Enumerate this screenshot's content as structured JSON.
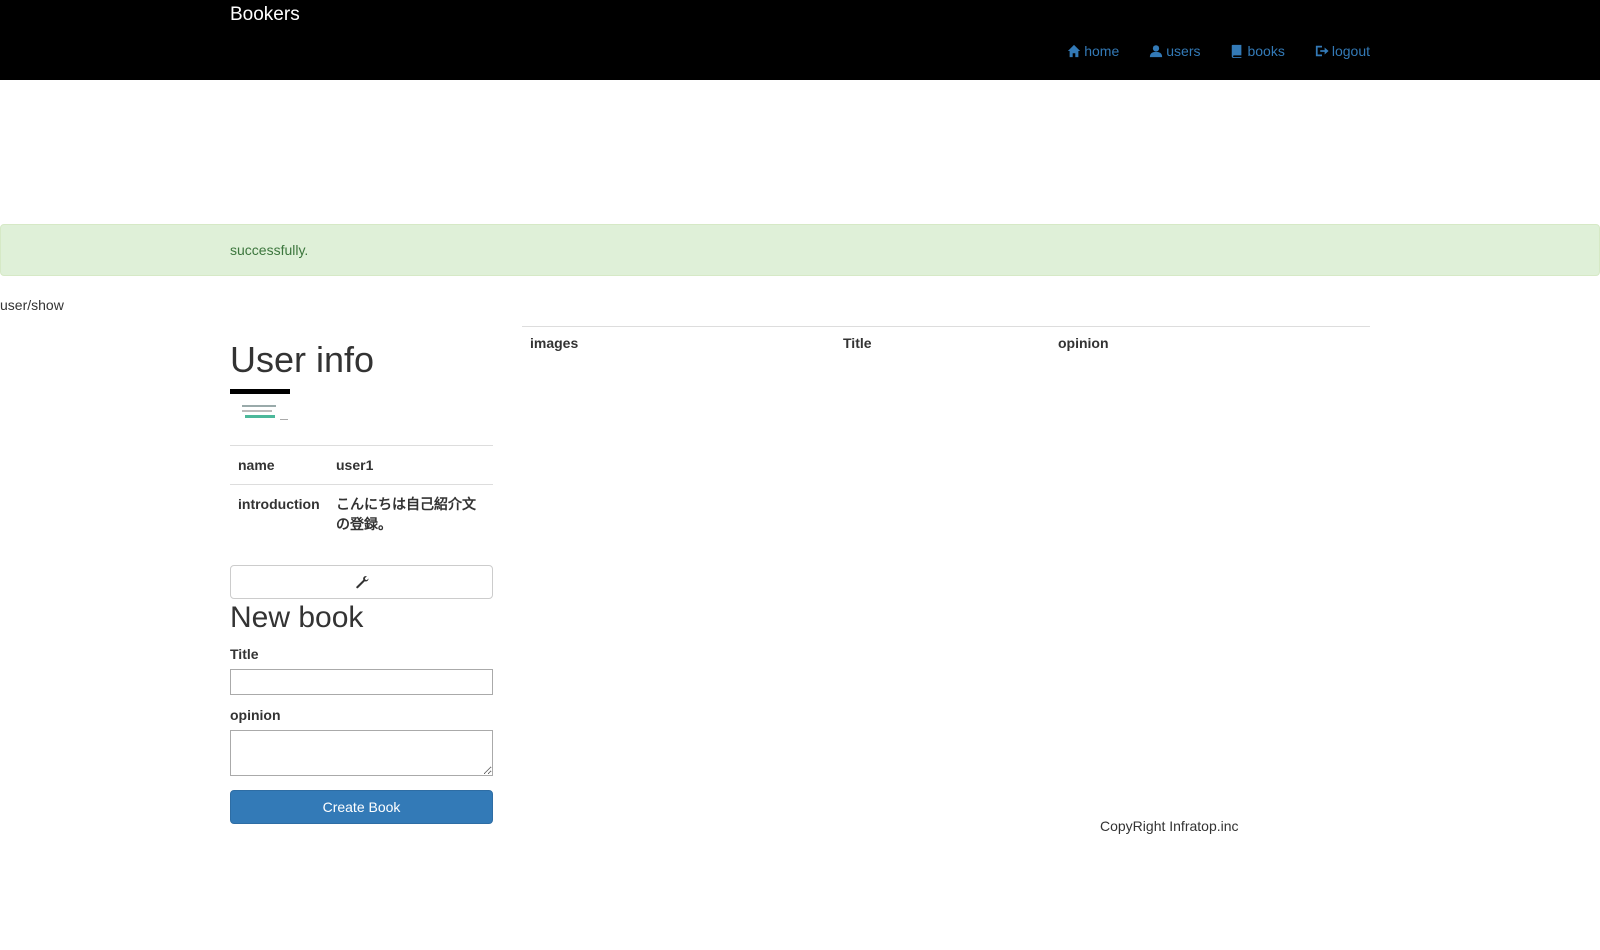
{
  "navbar": {
    "brand": "Bookers",
    "links": [
      {
        "label": "home",
        "icon": "home-icon"
      },
      {
        "label": "users",
        "icon": "user-icon"
      },
      {
        "label": "books",
        "icon": "book-icon"
      },
      {
        "label": "logout",
        "icon": "logout-icon"
      }
    ]
  },
  "flash": {
    "message": "successfully."
  },
  "route_label": "user/show",
  "user_info": {
    "heading": "User info",
    "rows": [
      {
        "key": "name",
        "value": "user1"
      },
      {
        "key": "introduction",
        "value": "こんにちは自己紹介文の登録。"
      }
    ],
    "edit_icon": "wrench-icon"
  },
  "new_book": {
    "heading": "New book",
    "title_label": "Title",
    "title_value": "",
    "opinion_label": "opinion",
    "opinion_value": "",
    "submit_label": "Create Book"
  },
  "books_table": {
    "headers": [
      "images",
      "Title",
      "opinion"
    ]
  },
  "footer": {
    "copyright": "CopyRight Infratop.inc"
  },
  "colors": {
    "navbar_bg": "#000000",
    "link": "#337ab7",
    "alert_bg": "#dff0d8",
    "alert_text": "#3c763d",
    "primary": "#337ab7"
  }
}
